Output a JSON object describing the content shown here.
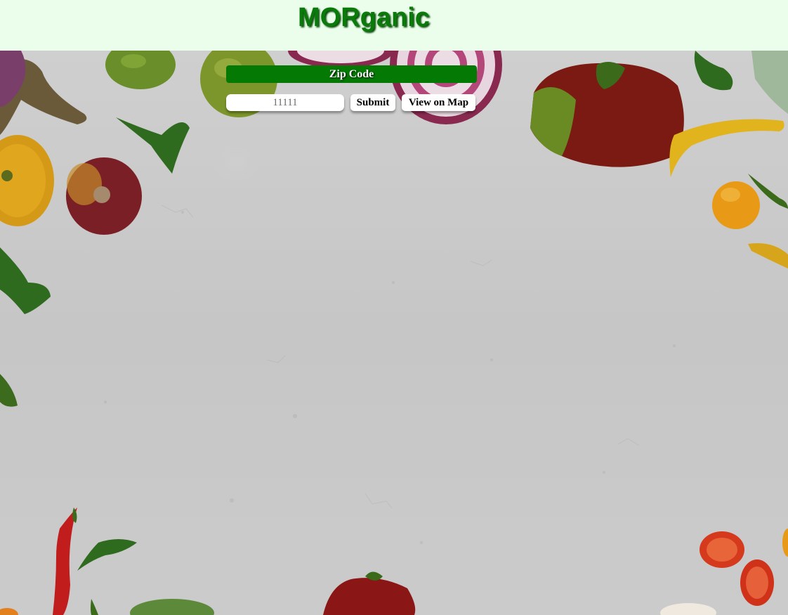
{
  "header": {
    "title": "MORganic"
  },
  "zip_form": {
    "banner_label": "Zip Code",
    "zip_value": "11111",
    "submit_label": "Submit",
    "map_label": "View on Map"
  },
  "colors": {
    "header_bg": "#ebfeeb",
    "logo_green": "#0a7a0a",
    "banner_green": "#047a04",
    "background_concrete": "#c9c9c9"
  },
  "background": {
    "description_icon": "vegetables-on-concrete-background"
  }
}
